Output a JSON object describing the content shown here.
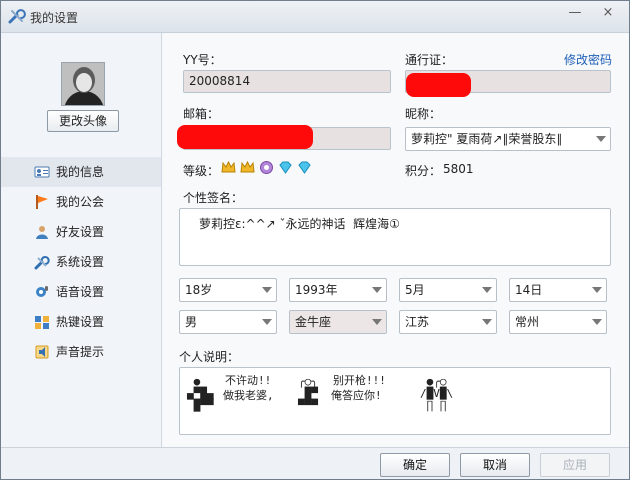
{
  "window": {
    "title": "我的设置",
    "minimize_glyph": "—",
    "close_glyph": "×"
  },
  "sidebar": {
    "change_avatar_label": "更改头像",
    "items": [
      {
        "label": "我的信息",
        "icon": "profile-card-icon"
      },
      {
        "label": "我的公会",
        "icon": "flag-icon"
      },
      {
        "label": "好友设置",
        "icon": "friends-icon"
      },
      {
        "label": "系统设置",
        "icon": "wrench-icon"
      },
      {
        "label": "语音设置",
        "icon": "voice-gear-icon"
      },
      {
        "label": "热键设置",
        "icon": "hotkey-icon"
      },
      {
        "label": "声音提示",
        "icon": "sound-alert-icon"
      }
    ]
  },
  "form": {
    "yy_label": "YY号：",
    "yy_value": "20008814",
    "pass_label": "通行证：",
    "change_password": "修改密码",
    "email_label": "邮箱：",
    "nickname_label": "昵称：",
    "nickname_value": "萝莉控\" 夏雨荷↗∥荣誉股东∥",
    "level_label": "等级：",
    "points_label": "积分：",
    "points_value": "5801",
    "signature_label": "个性签名：",
    "signature_value": "萝莉控ε:^^↗ ˇ永远的神话  辉煌海①",
    "age": "18岁",
    "birth_year": "1993年",
    "birth_month": "5月",
    "birth_day": "14日",
    "gender": "男",
    "zodiac": "金牛座",
    "province": "江苏",
    "city": "常州",
    "intro_label": "个人说明：",
    "intro_text": {
      "line1": "不许动!!",
      "line2": "做我老婆,",
      "line3": "别开枪!!!",
      "line4": "俺答应你!"
    }
  },
  "buttons": {
    "ok": "确定",
    "cancel": "取消",
    "apply": "应用"
  },
  "colors": {
    "link": "#1e5fb7",
    "redaction": "#ff0a0a",
    "selected_nav": "#e2e7ee"
  }
}
